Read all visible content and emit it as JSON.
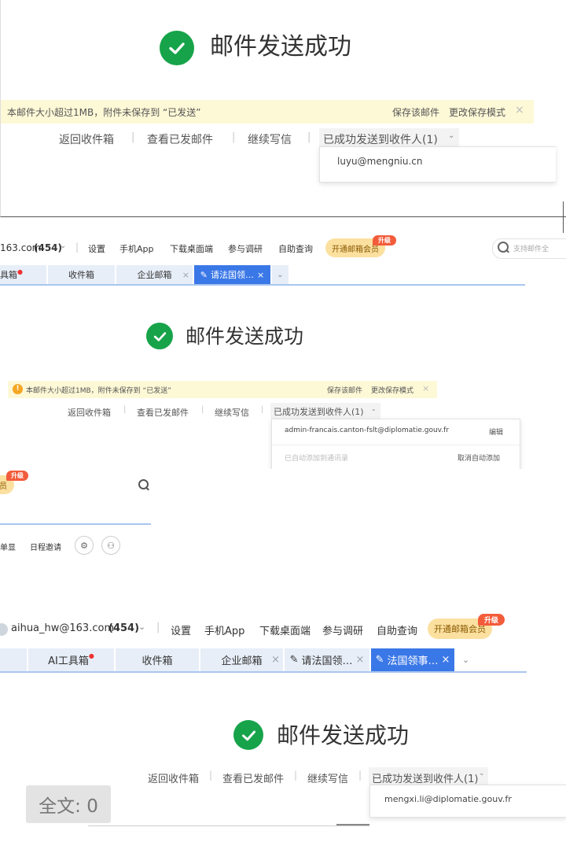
{
  "panel1": {
    "success_title": "邮件发送成功",
    "warning_text": "本邮件大小超过1MB，附件未保存到 “已发送”",
    "save_mail": "保存该邮件",
    "change_mode": "更改保存模式",
    "close": "×",
    "links": [
      "返回收件箱",
      "查看已发邮件",
      "继续写信",
      "已成功发送到收件人(1)"
    ],
    "recipient": "luyu@mengniu.cn"
  },
  "panel2": {
    "account": "163.com",
    "count": "(454)",
    "nav": [
      "设置",
      "手机App",
      "下载桌面端",
      "参与调研",
      "自助查询"
    ],
    "vip": "开通邮箱会员",
    "upgrade": "升级",
    "search_placeholder": "支持邮件全",
    "tabs": [
      "具箱",
      "收件箱",
      "企业邮箱",
      "请法国领…"
    ],
    "success_title": "邮件发送成功",
    "warning_text": "本邮件大小超过1MB，附件未保存到 “已发送”",
    "save_mail": "保存该邮件",
    "change_mode": "更改保存模式",
    "close": "×",
    "links": [
      "返回收件箱",
      "查看已发邮件",
      "继续写信",
      "已成功发送到收件人(1)"
    ],
    "recipient": "admin-francais.canton-fslt@diplomatie.gouv.fr",
    "edit": "编辑",
    "auto_added": "已自动添加到通讯录",
    "cancel_auto": "取消自动添加"
  },
  "fragment": {
    "vip_partial": "员",
    "upgrade": "升级",
    "toolbar": [
      "单显",
      "日程邀请"
    ]
  },
  "panel3": {
    "account": "aihua_hw@163.com",
    "count": "(454)",
    "nav": [
      "设置",
      "手机App",
      "下载桌面端",
      "参与调研",
      "自助查询"
    ],
    "vip": "开通邮箱会员",
    "upgrade": "升级",
    "tabs": [
      "AI工具箱",
      "收件箱",
      "企业邮箱",
      "请法国领…",
      "法国领事…"
    ],
    "success_title": "邮件发送成功",
    "links": [
      "返回收件箱",
      "查看已发邮件",
      "继续写信",
      "已成功发送到收件人(1)"
    ],
    "recipient": "mengxi.li@diplomatie.gouv.fr"
  },
  "word_count": "全文: 0",
  "colors": {
    "success": "#17a34a",
    "warning_bg": "#fdf8d6",
    "tab_active": "#3b78e7",
    "tab_bg": "#e7eef8",
    "upgrade": "#f25c3b",
    "vip_bg": "#fbe0a0"
  }
}
